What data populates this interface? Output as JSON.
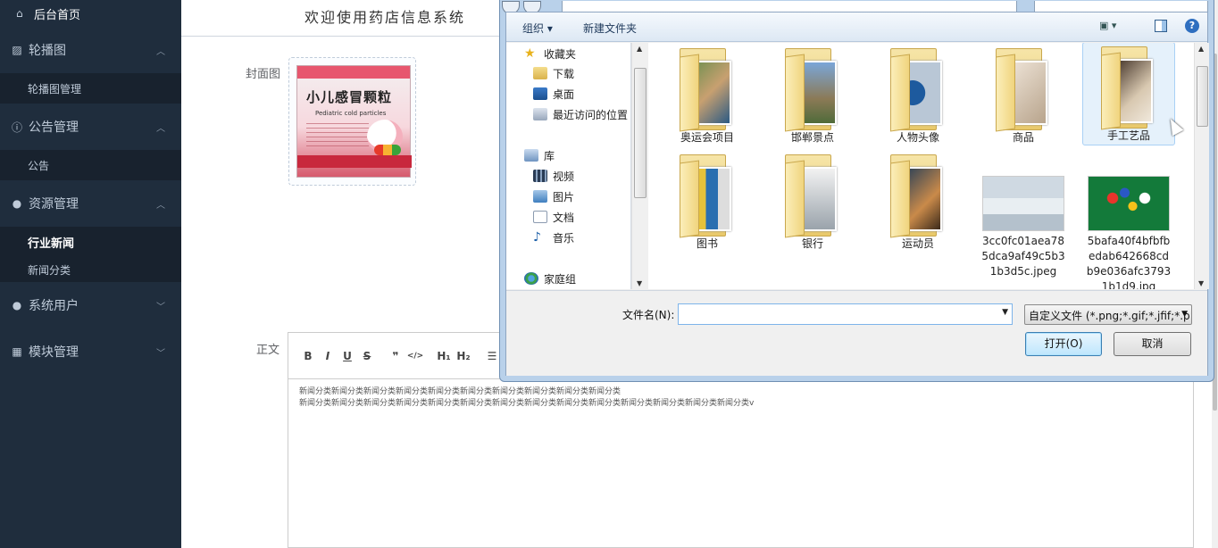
{
  "sidebar": {
    "home": "后台首页",
    "groups": [
      {
        "label": "轮播图",
        "icon": "image-icon",
        "items": [
          "轮播图管理"
        ]
      },
      {
        "label": "公告管理",
        "icon": "info-circle-icon",
        "items": [
          "公告"
        ]
      },
      {
        "label": "资源管理",
        "icon": "location-pin-icon",
        "items": [
          "行业新闻",
          "新闻分类"
        ]
      },
      {
        "label": "系统用户",
        "icon": "user-icon",
        "items": []
      },
      {
        "label": "模块管理",
        "icon": "grid-icon",
        "items": []
      }
    ]
  },
  "header": {
    "welcome": "欢迎使用药店信息系统"
  },
  "form": {
    "cover_label": "封面图",
    "cover_image": {
      "title": "小儿感冒颗粒",
      "subtitle": "Pediatric cold particles"
    },
    "body_label": "正文",
    "toolbar": [
      "B",
      "I",
      "U",
      "S",
      "❞",
      "</>",
      "H₁",
      "H₂",
      "☰"
    ],
    "content_lines": [
      "新闻分类新闻分类新闻分类新闻分类新闻分类新闻分类新闻分类新闻分类新闻分类新闻分类",
      "新闻分类新闻分类新闻分类新闻分类新闻分类新闻分类新闻分类新闻分类新闻分类新闻分类新闻分类新闻分类新闻分类新闻分类v"
    ]
  },
  "dialog": {
    "toolbar": {
      "organize": "组织 ▾",
      "new_folder": "新建文件夹",
      "help": "?"
    },
    "nav": {
      "favorites": "收藏夹",
      "downloads": "下载",
      "desktop": "桌面",
      "recent": "最近访问的位置",
      "libraries": "库",
      "videos": "视频",
      "pictures": "图片",
      "documents": "文档",
      "music": "音乐",
      "homegroup": "家庭组"
    },
    "files": [
      {
        "name": "奥运会项目",
        "type": "folder",
        "selected": false
      },
      {
        "name": "邯郸景点",
        "type": "folder",
        "selected": false
      },
      {
        "name": "人物头像",
        "type": "folder",
        "selected": false
      },
      {
        "name": "商品",
        "type": "folder",
        "selected": false
      },
      {
        "name": "手工艺品",
        "type": "folder",
        "selected": true
      },
      {
        "name": "图书",
        "type": "folder",
        "selected": false
      },
      {
        "name": "银行",
        "type": "folder",
        "selected": false
      },
      {
        "name": "运动员",
        "type": "folder",
        "selected": false
      },
      {
        "name": "3cc0fc01aea785dca9af49c5b31b3d5c.jpeg",
        "type": "image",
        "selected": false
      },
      {
        "name": "5bafa40f4bfbfbedab642668cdb9e036afc37931b1d9.jpg",
        "type": "image",
        "selected": false
      }
    ],
    "filename_label": "文件名(N):",
    "filename_value": "",
    "filter": "自定义文件 (*.png;*.gif;*.jfif;*.p",
    "open_button": "打开(O)",
    "cancel_button": "取消"
  },
  "colors": {
    "sidebar_bg": "#1f2d3d",
    "dialog_frame": "#b9d1ea"
  }
}
